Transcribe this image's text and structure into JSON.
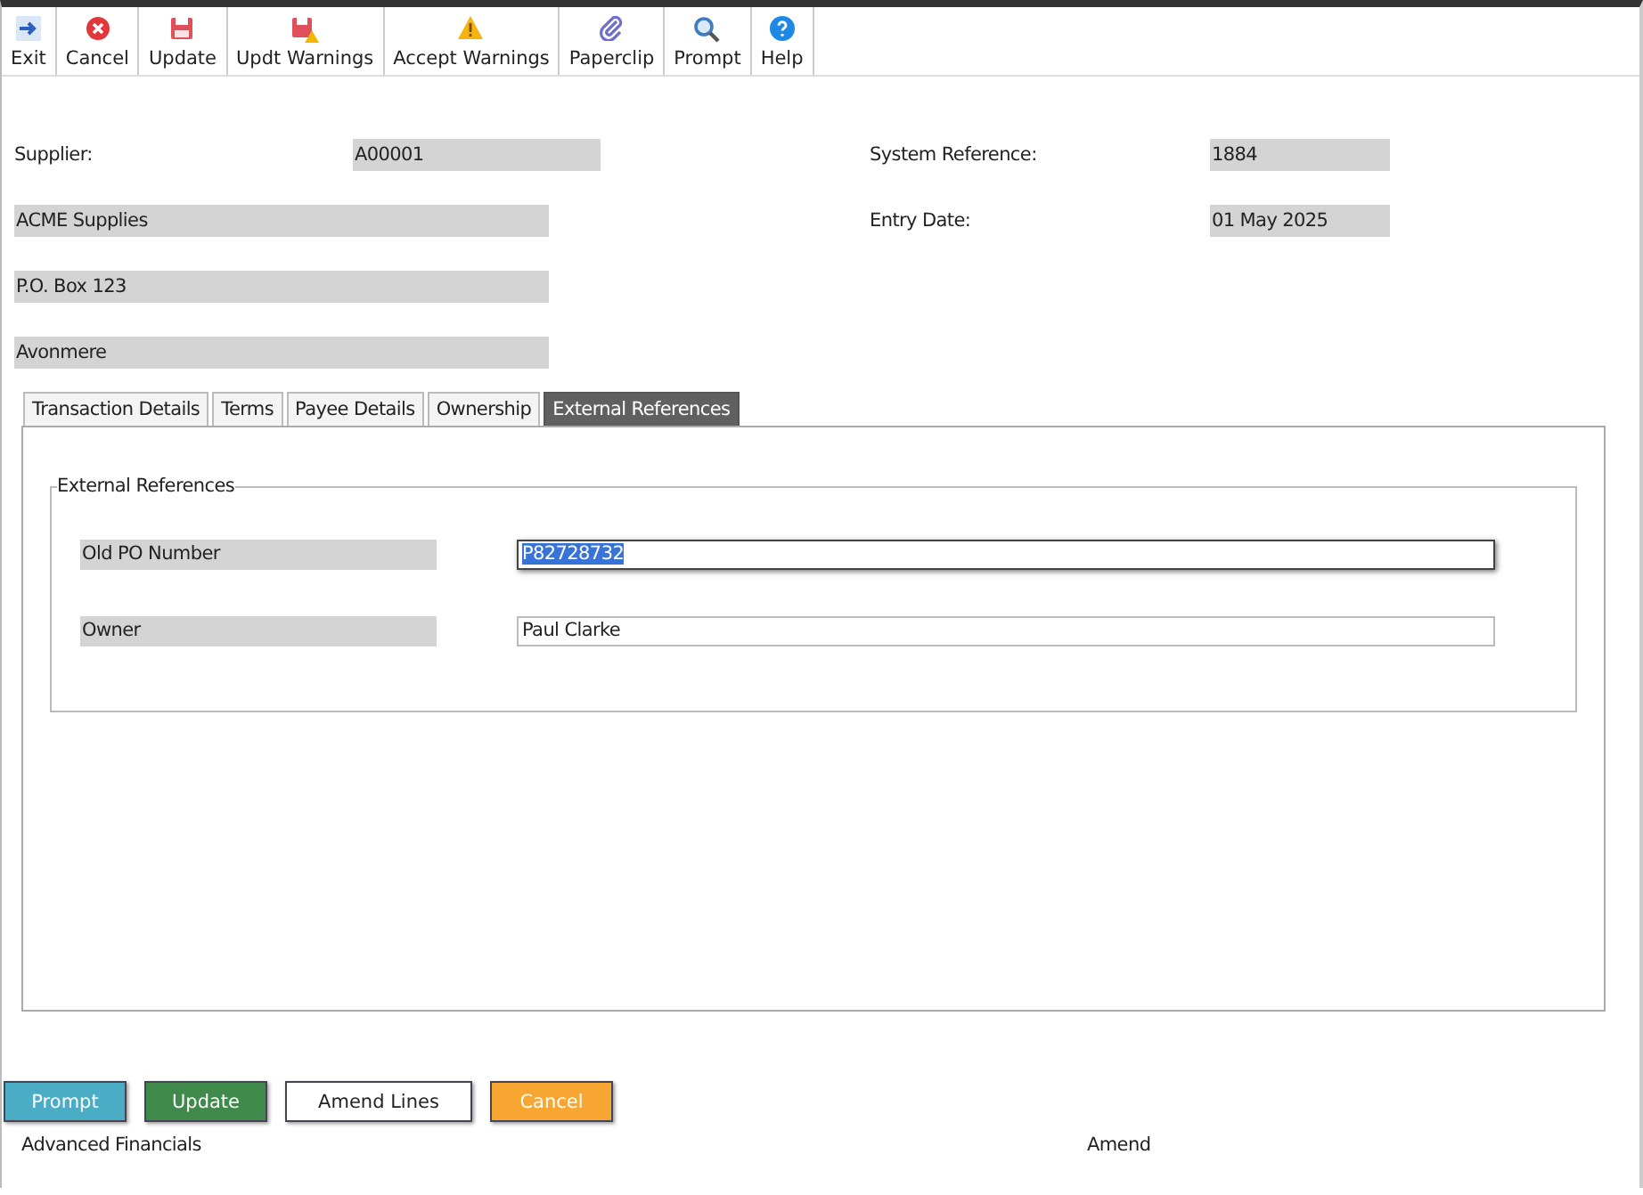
{
  "toolbar": [
    {
      "label": "Exit"
    },
    {
      "label": "Cancel"
    },
    {
      "label": "Update"
    },
    {
      "label": "Updt Warnings"
    },
    {
      "label": "Accept Warnings"
    },
    {
      "label": "Paperclip"
    },
    {
      "label": "Prompt"
    },
    {
      "label": "Help"
    }
  ],
  "header": {
    "supplier_label": "Supplier:",
    "supplier_code": "A00001",
    "supplier_name": "ACME Supplies",
    "address_line_1": "P.O. Box 123",
    "address_line_2": "Avonmere",
    "system_reference_label": "System Reference:",
    "system_reference": "1884",
    "entry_date_label": "Entry Date:",
    "entry_date": "01 May 2025"
  },
  "tabs": [
    {
      "label": "Transaction Details",
      "selected": false
    },
    {
      "label": "Terms",
      "selected": false
    },
    {
      "label": "Payee Details",
      "selected": false
    },
    {
      "label": "Ownership",
      "selected": false
    },
    {
      "label": "External References",
      "selected": true
    }
  ],
  "fieldset": {
    "legend": "External References",
    "fields": [
      {
        "label": "Old PO Number",
        "value": "P82728732",
        "focused": true,
        "text_selected": true
      },
      {
        "label": "Owner",
        "value": "Paul Clarke",
        "focused": false,
        "text_selected": false
      }
    ]
  },
  "buttons": [
    {
      "label": "Prompt",
      "color": "#4bacc6"
    },
    {
      "label": "Update",
      "color": "#3f8a4a"
    },
    {
      "label": "Amend Lines",
      "color": "#ffffff"
    },
    {
      "label": "Cancel",
      "color": "#f8a632"
    }
  ],
  "status_bar": {
    "left": "Advanced Financials",
    "right": "Amend"
  }
}
